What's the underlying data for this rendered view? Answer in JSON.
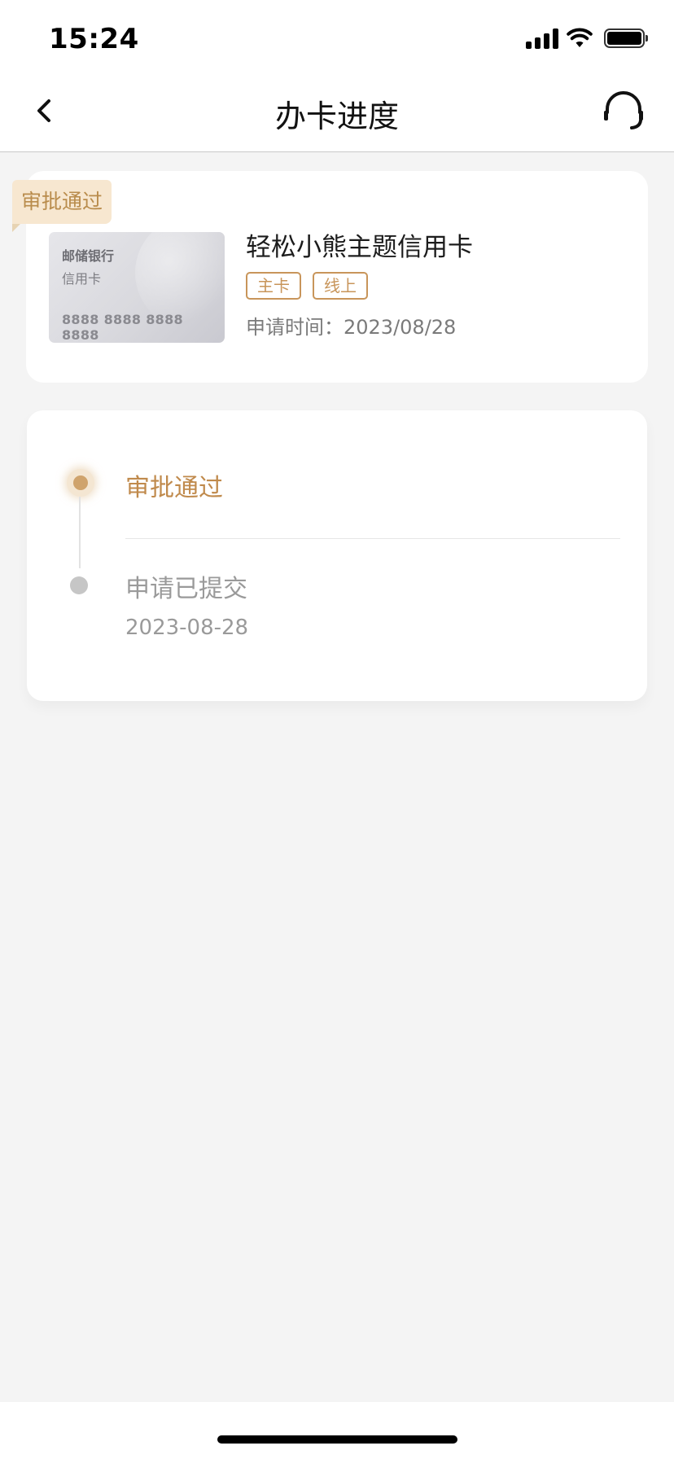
{
  "status_bar": {
    "time": "15:24"
  },
  "nav": {
    "title": "办卡进度"
  },
  "card_summary": {
    "status_tag": "审批通过",
    "card_image": {
      "bank": "邮储银行",
      "type": "信用卡",
      "number": "8888 8888 8888 8888"
    },
    "card_name": "轻松小熊主题信用卡",
    "badges": [
      "主卡",
      "线上"
    ],
    "apply_time": "申请时间：2023/08/28"
  },
  "progress": {
    "steps": [
      {
        "label": "审批通过",
        "date": "",
        "state": "active"
      },
      {
        "label": "申请已提交",
        "date": "2023-08-28",
        "state": "done"
      }
    ]
  },
  "colors": {
    "accent": "#c08a4c",
    "tag_bg": "#f7e7d0",
    "muted": "#9a9a9a",
    "background": "#f4f4f4"
  }
}
